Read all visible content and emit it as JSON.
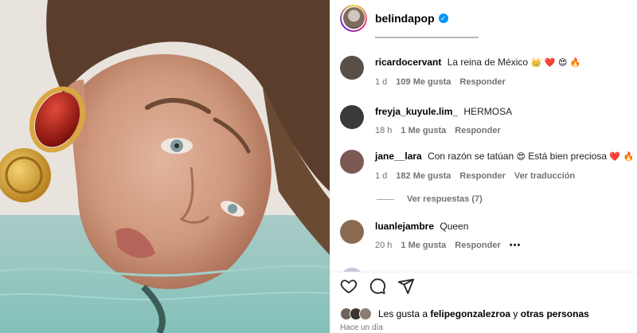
{
  "post": {
    "username": "belindapop",
    "photo_alt": ""
  },
  "comments": [
    {
      "username": "ricardocervant",
      "text": "La reina de México",
      "emojis": "👑 ❤️ 😍 🔥",
      "time": "1 d",
      "likes": "109 Me gusta",
      "reply": "Responder",
      "avatar_color": "#5a4f47"
    },
    {
      "username": "freyja_kuyule.lim_",
      "text": "HERMOSA",
      "emojis": "",
      "time": "18 h",
      "likes": "1 Me gusta",
      "reply": "Responder",
      "avatar_color": "#3a3a3a"
    },
    {
      "username": "jane__lara",
      "text": "Con razón se tatúan",
      "emojis": "😍",
      "text2": "Está bien preciosa",
      "emojis2": "❤️ 🔥",
      "time": "1 d",
      "likes": "182 Me gusta",
      "reply": "Responder",
      "translate": "Ver traducción",
      "avatar_color": "#7a5a52"
    },
    {
      "username": "luanlejambre",
      "text": "Queen",
      "emojis": "",
      "time": "20 h",
      "likes": "1 Me gusta",
      "reply": "Responder",
      "more": "•••",
      "avatar_color": "#8a6a50"
    }
  ],
  "view_replies": "Ver respuestas (7)",
  "likes_line": {
    "prefix": "Les gusta a",
    "user": "felipegonzalezroa",
    "middle": "y",
    "suffix": "otras personas"
  },
  "time_ago": "Hace un día",
  "colors": {
    "verified": "#0095f6",
    "meta": "#737373",
    "heart_red": "#ed4956"
  },
  "icons": [
    "heart-icon",
    "comment-icon",
    "share-icon",
    "verified-icon"
  ]
}
